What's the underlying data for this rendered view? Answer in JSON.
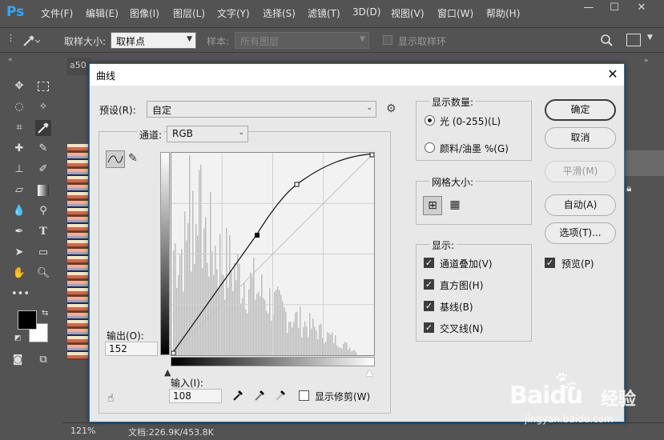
{
  "app": {
    "logo": "Ps"
  },
  "menu": [
    "文件(F)",
    "编辑(E)",
    "图像(I)",
    "图层(L)",
    "文字(Y)",
    "选择(S)",
    "滤镜(T)",
    "3D(D)",
    "视图(V)",
    "窗口(W)",
    "帮助(H)"
  ],
  "options": {
    "sample_size_label": "取样大小:",
    "sample_size_value": "取样点",
    "sample_label": "样本:",
    "sample_value": "所有图层",
    "show_ring_label": "显示取样环"
  },
  "document": {
    "tab": "a50",
    "zoom": "121%",
    "doc_info": "文档:226.9K/453.8K"
  },
  "dialog": {
    "title": "曲线",
    "preset_label": "预设(R):",
    "preset_value": "自定",
    "channel_label": "通道:",
    "channel_value": "RGB",
    "output_label": "输出(O):",
    "output_value": "152",
    "input_label": "输入(I):",
    "input_value": "108",
    "show_clipping_label": "显示修剪(W)",
    "show_amount": {
      "title": "显示数量:",
      "options": [
        "光 (0-255)(L)",
        "颜料/油墨 %(G)"
      ],
      "selected": 0
    },
    "grid_size_title": "网格大小:",
    "display": {
      "title": "显示:",
      "options": [
        {
          "label": "通道叠加(V)",
          "checked": true
        },
        {
          "label": "直方图(H)",
          "checked": true
        },
        {
          "label": "基线(B)",
          "checked": true
        },
        {
          "label": "交叉线(N)",
          "checked": true
        }
      ]
    },
    "buttons": {
      "ok": "确定",
      "cancel": "取消",
      "smooth": "平滑(M)",
      "auto": "自动(A)",
      "options": "选项(T)..."
    },
    "preview_label": "预览(P)",
    "preview_checked": true
  },
  "watermark": {
    "brand": "Baidu",
    "suffix": "经验",
    "url": "jingyan.baidu.com"
  }
}
